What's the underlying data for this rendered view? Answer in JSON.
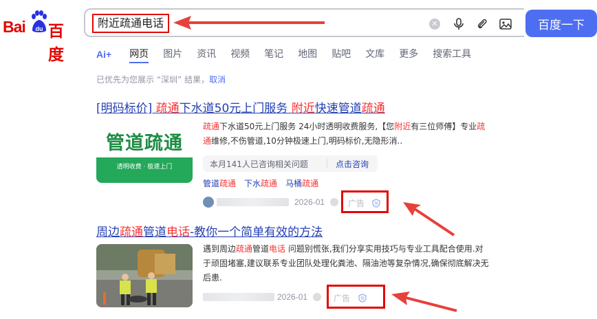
{
  "logo": {
    "left_text": "Bai",
    "right_text": "百度"
  },
  "search": {
    "query": "附近疏通电话",
    "button_label": "百度一下"
  },
  "tabs": [
    {
      "label": "Ai+"
    },
    {
      "label": "网页"
    },
    {
      "label": "图片"
    },
    {
      "label": "资讯"
    },
    {
      "label": "视频"
    },
    {
      "label": "笔记"
    },
    {
      "label": "地图"
    },
    {
      "label": "贴吧"
    },
    {
      "label": "文库"
    },
    {
      "label": "更多"
    },
    {
      "label": "搜索工具"
    }
  ],
  "notice": {
    "text": "已优先为您展示 “深圳” 结果，",
    "cancel": "取消"
  },
  "result1": {
    "title_parts": [
      "[明码标价] ",
      "疏通",
      "下水道50元上门服务 ",
      "附近",
      "快速管道",
      "疏通"
    ],
    "image_big": "管道疏通",
    "image_small": "透明收费 · 极速上门",
    "snippet_l1": [
      "疏通",
      "下水道50元上门服务 24小时透明收费服务,【您",
      "附近",
      "有三位师傅】专业",
      "疏"
    ],
    "snippet_l2": [
      "通",
      "维修,不伤管道,10分钟极速上门,明码标价,无隐形消.."
    ],
    "consult_q": "本月141人已咨询相关问题",
    "consult_a": "点击咨询",
    "related": [
      {
        "a": "管道",
        "b": "疏通"
      },
      {
        "a": "下水",
        "b": "疏通"
      },
      {
        "a": "马桶",
        "b": "疏通"
      }
    ],
    "date": "2026-01",
    "ad": "广告"
  },
  "result2": {
    "title_parts": [
      "周边",
      "疏通",
      "管道",
      "电话",
      "-教你一个简单有效的方法"
    ],
    "snippet_l1": [
      "遇到周边",
      "疏通",
      "管道",
      "电话",
      " 问题别慌张,我们分享实用技巧与专业工具配合使用.对"
    ],
    "snippet_l2": "于顽固堵塞,建议联系专业团队处理化粪池、隔油池等复杂情况,确保彻底解决无",
    "snippet_l3": "后患.",
    "date": "2026-01",
    "ad": "广告"
  },
  "colors": {
    "brand_red": "#e10602",
    "accent_blue": "#4e6ef2",
    "link_blue": "#2440b3",
    "highlight_red": "#f73131"
  }
}
